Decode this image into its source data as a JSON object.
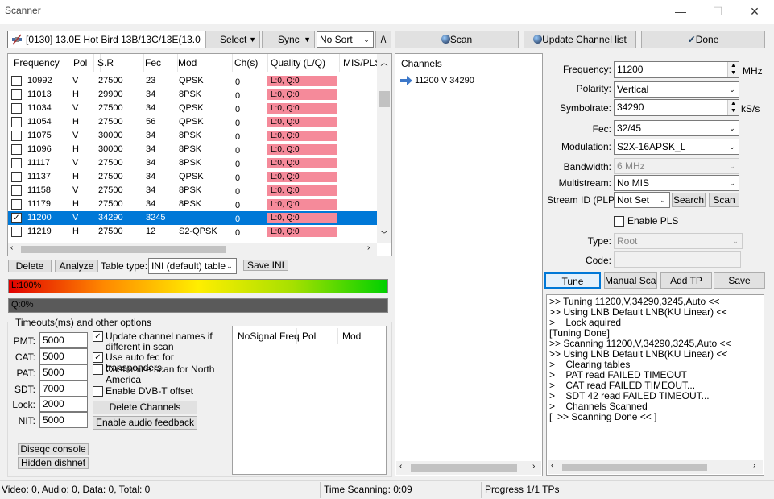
{
  "window": {
    "title": "Scanner",
    "minimize": "—",
    "maximize": "☐",
    "close": "✕"
  },
  "toolbar": {
    "satellite": "[0130]  13.0E  Hot Bird 13B/13C/13E(13.0",
    "select_label": "Select",
    "sync_label": "Sync",
    "sort_value": "No Sort",
    "slash_label": "/\\",
    "scan_label": "Scan",
    "update_label": "Update Channel list",
    "done_label": "Done"
  },
  "transponders": {
    "columns": [
      "Frequency",
      "Pol",
      "S.R",
      "Fec",
      "Mod",
      "Ch(s)",
      "Quality (L/Q)",
      "MIS/PLS,"
    ],
    "rows": [
      {
        "checked": false,
        "freq": "10992",
        "pol": "V",
        "sr": "27500",
        "fec": "23",
        "mod": "QPSK",
        "ch": "0",
        "quality": "L:0, Q:0",
        "selected": false
      },
      {
        "checked": false,
        "freq": "11013",
        "pol": "H",
        "sr": "29900",
        "fec": "34",
        "mod": "8PSK",
        "ch": "0",
        "quality": "L:0, Q:0",
        "selected": false
      },
      {
        "checked": false,
        "freq": "11034",
        "pol": "V",
        "sr": "27500",
        "fec": "34",
        "mod": "QPSK",
        "ch": "0",
        "quality": "L:0, Q:0",
        "selected": false
      },
      {
        "checked": false,
        "freq": "11054",
        "pol": "H",
        "sr": "27500",
        "fec": "56",
        "mod": "QPSK",
        "ch": "0",
        "quality": "L:0, Q:0",
        "selected": false
      },
      {
        "checked": false,
        "freq": "11075",
        "pol": "V",
        "sr": "30000",
        "fec": "34",
        "mod": "8PSK",
        "ch": "0",
        "quality": "L:0, Q:0",
        "selected": false
      },
      {
        "checked": false,
        "freq": "11096",
        "pol": "H",
        "sr": "30000",
        "fec": "34",
        "mod": "8PSK",
        "ch": "0",
        "quality": "L:0, Q:0",
        "selected": false
      },
      {
        "checked": false,
        "freq": "11117",
        "pol": "V",
        "sr": "27500",
        "fec": "34",
        "mod": "8PSK",
        "ch": "0",
        "quality": "L:0, Q:0",
        "selected": false
      },
      {
        "checked": false,
        "freq": "11137",
        "pol": "H",
        "sr": "27500",
        "fec": "34",
        "mod": "QPSK",
        "ch": "0",
        "quality": "L:0, Q:0",
        "selected": false
      },
      {
        "checked": false,
        "freq": "11158",
        "pol": "V",
        "sr": "27500",
        "fec": "34",
        "mod": "8PSK",
        "ch": "0",
        "quality": "L:0, Q:0",
        "selected": false
      },
      {
        "checked": false,
        "freq": "11179",
        "pol": "H",
        "sr": "27500",
        "fec": "34",
        "mod": "8PSK",
        "ch": "0",
        "quality": "L:0, Q:0",
        "selected": false
      },
      {
        "checked": true,
        "freq": "11200",
        "pol": "V",
        "sr": "34290",
        "fec": "3245",
        "mod": "",
        "ch": "0",
        "quality": "L:0, Q:0",
        "selected": true
      },
      {
        "checked": false,
        "freq": "11219",
        "pol": "H",
        "sr": "27500",
        "fec": "12",
        "mod": "S2-QPSK",
        "ch": "0",
        "quality": "L:0, Q:0",
        "selected": false
      }
    ]
  },
  "list_actions": {
    "delete_label": "Delete",
    "analyze_label": "Analyze",
    "table_type_label": "Table type:",
    "table_type_value": "INI (default) table",
    "save_ini_label": "Save INI"
  },
  "signal": {
    "level_label": "L:100%",
    "level_fraction": 1.0,
    "quality_label": "Q:0%",
    "quality_fraction": 0.0
  },
  "timeouts": {
    "title": "Timeouts(ms) and other options",
    "fields": [
      {
        "label": "PMT:",
        "value": "5000"
      },
      {
        "label": "CAT:",
        "value": "5000"
      },
      {
        "label": "PAT:",
        "value": "5000"
      },
      {
        "label": "SDT:",
        "value": "7000"
      },
      {
        "label": "Lock:",
        "value": "2000"
      },
      {
        "label": "NIT:",
        "value": "5000"
      }
    ],
    "options": [
      {
        "checked": true,
        "label": "Update channel names if different in scan"
      },
      {
        "checked": true,
        "label": "Use auto fec for transponders"
      },
      {
        "checked": false,
        "label": "Customize scan for North America"
      },
      {
        "checked": false,
        "label": "Enable DVB-T offset"
      }
    ],
    "delete_channels_label": "Delete Channels",
    "audio_feedback_label": "Enable audio feedback",
    "diseqc_label": "Diseqc console",
    "hidden_dishnet_label": "Hidden dishnet"
  },
  "nosignal": {
    "columns": [
      "NoSignal Freq",
      "Pol",
      "Mod"
    ]
  },
  "channels": {
    "header": "Channels",
    "items": [
      {
        "label": "11200 V 34290",
        "icon": "arrow-right-icon"
      }
    ]
  },
  "params": {
    "frequency_label": "Frequency:",
    "frequency_value": "11200",
    "frequency_unit": "MHz",
    "polarity_label": "Polarity:",
    "polarity_value": "Vertical",
    "symbolrate_label": "Symbolrate:",
    "symbolrate_value": "34290",
    "symbolrate_unit": "kS/s",
    "fec_label": "Fec:",
    "fec_value": "32/45",
    "modulation_label": "Modulation:",
    "modulation_value": "S2X-16APSK_L",
    "bandwidth_label": "Bandwidth:",
    "bandwidth_value": "6 MHz",
    "multistream_label": "Multistream:",
    "multistream_value": "No MIS",
    "streamid_label": "Stream ID (PLP):",
    "streamid_value": "Not Set",
    "search_label": "Search",
    "scan_label": "Scan",
    "enable_pls_label": "Enable PLS",
    "type_label": "Type:",
    "type_value": "Root",
    "code_label": "Code:",
    "code_value": ""
  },
  "actions": {
    "tune_label": "Tune",
    "manual_scan_label": "Manual Scan",
    "add_tp_label": "Add TP",
    "save_label": "Save"
  },
  "log": {
    "lines": [
      ">> Tuning 11200,V,34290,3245,Auto <<",
      ">> Using LNB Default LNB(KU Linear) <<",
      ">    Lock aquired",
      "[Tuning Done]",
      ">> Scanning 11200,V,34290,3245,Auto <<",
      ">> Using LNB Default LNB(KU Linear) <<",
      ">    Clearing tables",
      ">    PAT read FAILED TIMEOUT",
      ">    CAT read FAILED TIMEOUT...",
      ">    SDT 42 read FAILED TIMEOUT...",
      ">    Channels Scanned",
      "[  >> Scanning Done << ]"
    ]
  },
  "status": {
    "counts": "Video: 0, Audio: 0, Data: 0, Total: 0",
    "time": "Time Scanning: 0:09",
    "progress": "Progress 1/1 TPs"
  },
  "colors": {
    "selection": "#0078d7",
    "quality_bad": "#f58a9a",
    "qbar": "#5a5a5a"
  }
}
